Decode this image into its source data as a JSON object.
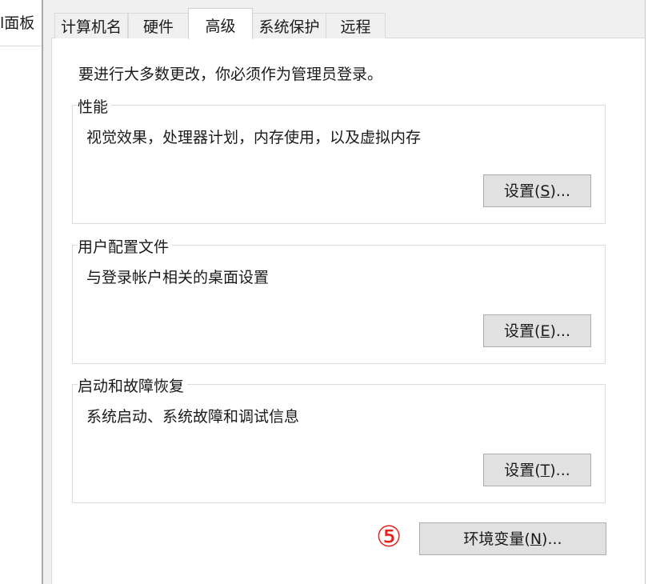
{
  "background_window": {
    "title_fragment": "l面板"
  },
  "tabs": [
    {
      "label": "计算机名",
      "active": false
    },
    {
      "label": "硬件",
      "active": false
    },
    {
      "label": "高级",
      "active": true
    },
    {
      "label": "系统保护",
      "active": false
    },
    {
      "label": "远程",
      "active": false
    }
  ],
  "intro_text": "要进行大多数更改，你必须作为管理员登录。",
  "groups": {
    "performance": {
      "title": "性能",
      "description": "视觉效果，处理器计划，内存使用，以及虚拟内存",
      "button": {
        "prefix": "设置(",
        "accel": "S",
        "suffix": ")..."
      }
    },
    "user_profiles": {
      "title": "用户配置文件",
      "description": "与登录帐户相关的桌面设置",
      "button": {
        "prefix": "设置(",
        "accel": "E",
        "suffix": ")..."
      }
    },
    "startup_recovery": {
      "title": "启动和故障恢复",
      "description": "系统启动、系统故障和调试信息",
      "button": {
        "prefix": "设置(",
        "accel": "T",
        "suffix": ")..."
      }
    }
  },
  "env_button": {
    "prefix": "环境变量(",
    "accel": "N",
    "suffix": ")..."
  },
  "step_marker": "⑤",
  "colors": {
    "step_marker": "#e8211b",
    "button_face": "#e1e1e1",
    "dialog_bg": "#f0f0f0"
  }
}
